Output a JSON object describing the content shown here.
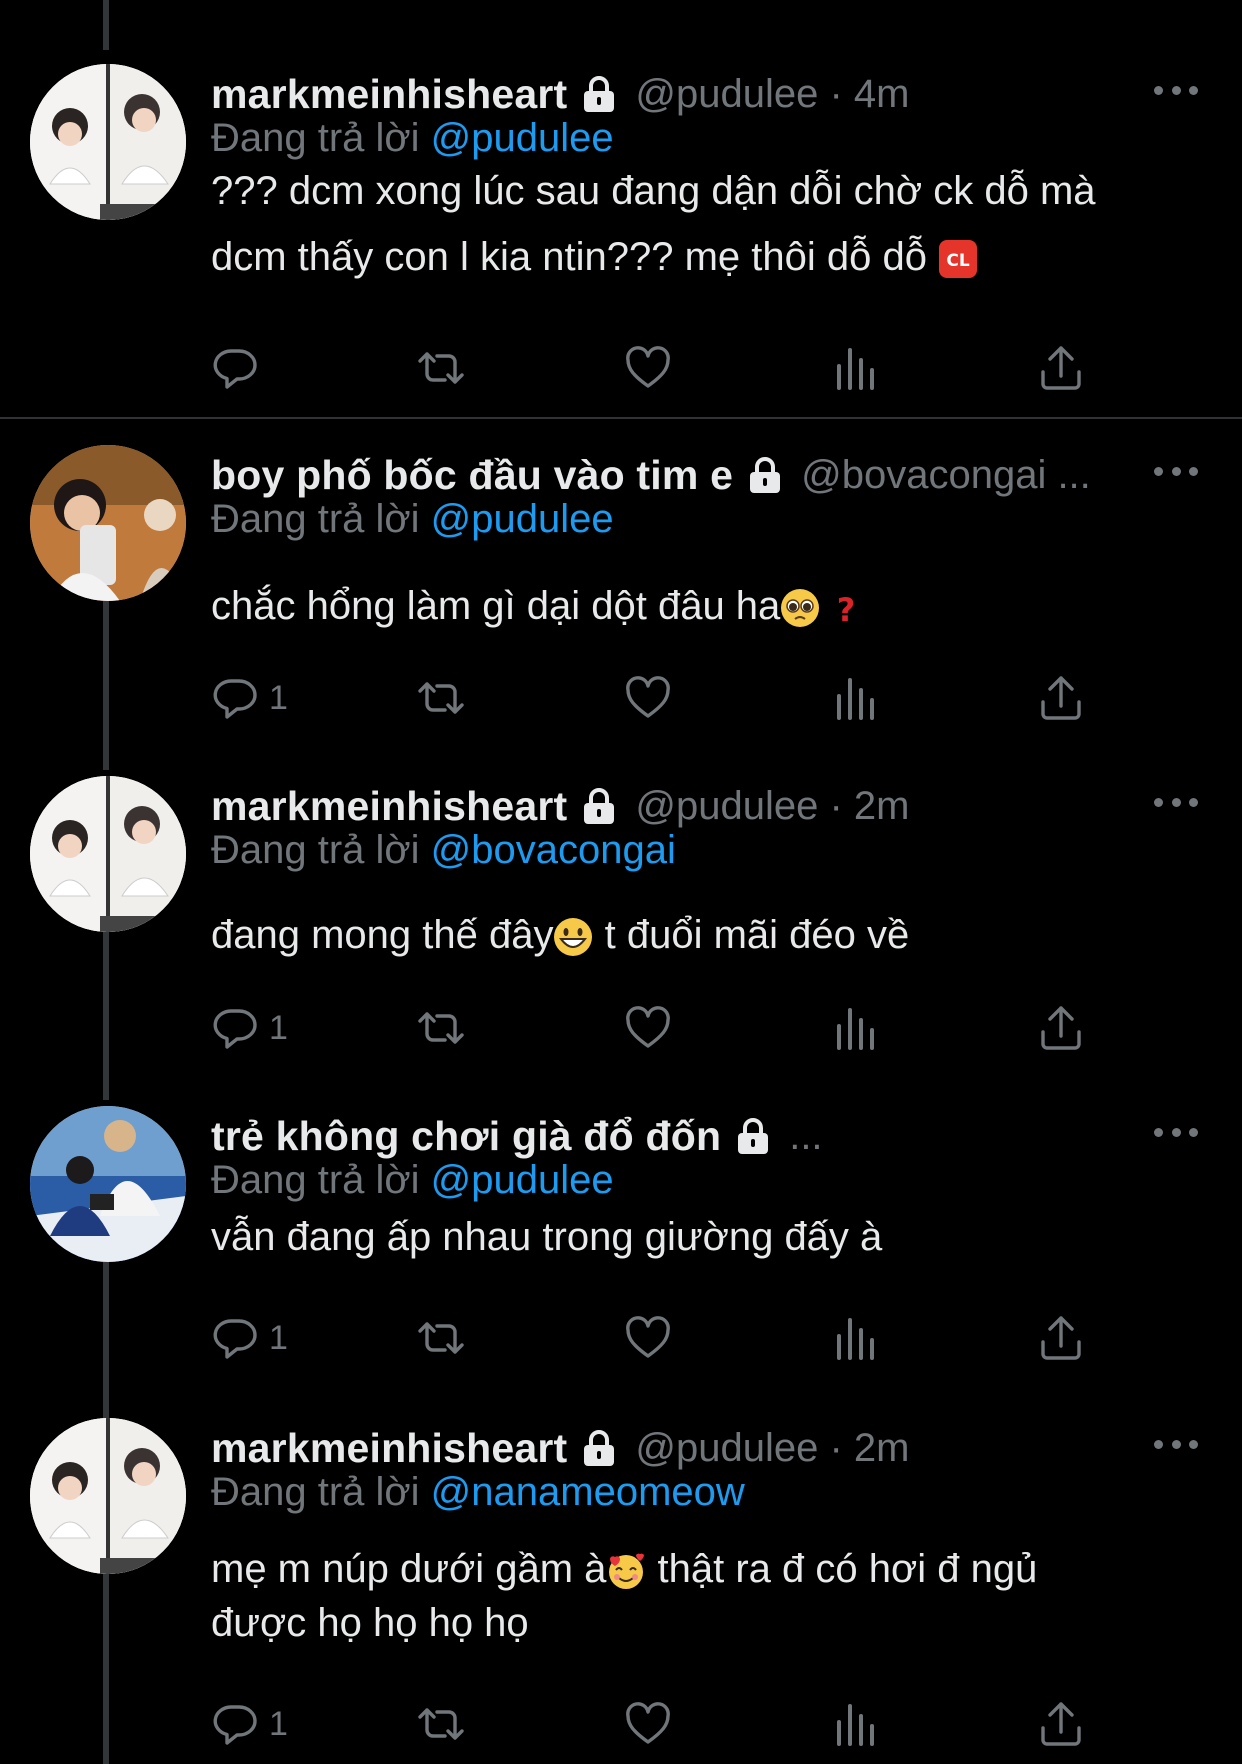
{
  "tweets": [
    {
      "name": "markmeinhisheart",
      "handle": "@pudulee",
      "time": "4m",
      "reply_label": "Đang trả lời",
      "reply_to": "@pudulee",
      "text_before": "??? dcm xong lúc sau đang dận dỗi chờ ck dỗ mà\ndcm thấy con l kia ntin??? mẹ thôi dỗ dỗ ",
      "text_after": "",
      "emoji": "cl-button",
      "reply_count": ""
    },
    {
      "name": "boy phố bốc đầu vào tim e",
      "handle": "@bovacongai ...",
      "time": "",
      "reply_label": "Đang trả lời",
      "reply_to": "@pudulee",
      "text_before": "chắc hổng làm gì dại dột đâu ha",
      "text_after": "",
      "emoji": "pleading-face + red-question-mark",
      "reply_count": "1"
    },
    {
      "name": "markmeinhisheart",
      "handle": "@pudulee",
      "time": "2m",
      "reply_label": "Đang trả lời",
      "reply_to": "@bovacongai",
      "text_before": "đang mong thế đây",
      "text_after": " t đuổi mãi đéo về",
      "emoji": "grinning-face",
      "reply_count": "1"
    },
    {
      "name": "trẻ không chơi già đổ đốn",
      "handle": "...",
      "time": "",
      "reply_label": "Đang trả lời",
      "reply_to": "@pudulee",
      "text_before": "vẫn đang ấp nhau trong giường đấy à",
      "text_after": "",
      "emoji": "",
      "reply_count": "1"
    },
    {
      "name": "markmeinhisheart",
      "handle": "@pudulee",
      "time": "2m",
      "reply_label": "Đang trả lời",
      "reply_to": "@nanameomeow",
      "text_before": "mẹ m núp dưới gầm à",
      "text_after": " thật ra đ có hơi đ ngủ\nđược họ họ họ họ",
      "emoji": "smiling-face-with-hearts",
      "reply_count": "1"
    }
  ],
  "colors": {
    "background": "#000000",
    "text": "#e7e9ea",
    "secondary": "#71767b",
    "accent": "#1d9bf0"
  },
  "icons": [
    "lock-icon",
    "more-icon",
    "reply-icon",
    "retweet-icon",
    "like-icon",
    "views-icon",
    "share-icon"
  ]
}
